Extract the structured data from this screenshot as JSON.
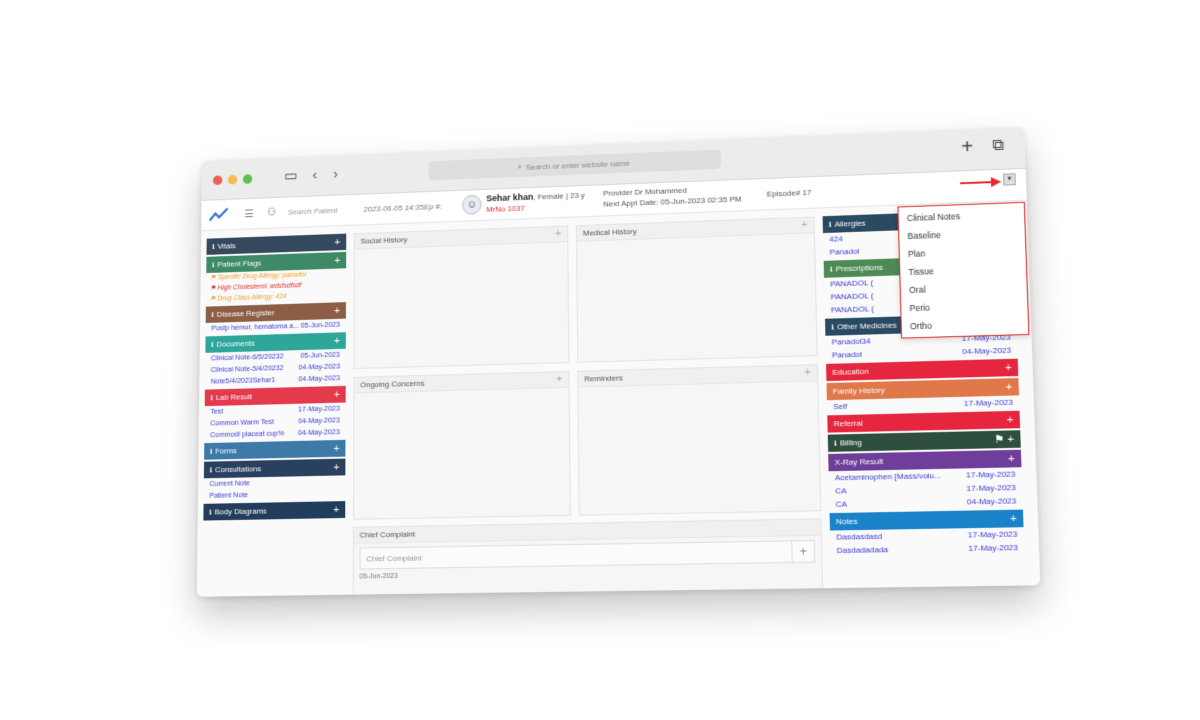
{
  "browser": {
    "address_placeholder": "Search or enter website name"
  },
  "header": {
    "search_placeholder": "Search Patient",
    "datetime": "2023-06-05 14:35Ep #:",
    "patient_name": "Sehar khan",
    "patient_info": ", Female | 23 y",
    "mrno": "MrNo 1037",
    "provider": "Provider   Dr Mohammed",
    "next_appt": "Next Appt Date: 05-Jun-2023 02:35 PM",
    "episode": "Episode# 17"
  },
  "left": {
    "vitals": "Vitals",
    "patient_flags": "Patient Flags",
    "flags": [
      "Specific Drug Allergy: panadol",
      "High Cholesterol: wdsfsdfsdf",
      "Drug Class Allergy: 424"
    ],
    "disease_register": "Disease Register",
    "disease_row": {
      "name": "Postp hemor, hematoma a...",
      "date": "05-Jun-2023"
    },
    "documents": "Documents",
    "documents_rows": [
      {
        "name": "Clinical Note-6/5/20232",
        "date": "05-Jun-2023"
      },
      {
        "name": "Clinical Note-5/4/20232",
        "date": "04-May-2023"
      },
      {
        "name": "Note5/4/2023Sehar1",
        "date": "04-May-2023"
      }
    ],
    "lab_result": "Lab Result",
    "lab_rows": [
      {
        "name": "Test",
        "date": "17-May-2023"
      },
      {
        "name": "Common Warm Test",
        "date": "04-May-2023"
      },
      {
        "name": "Commodi placeat cup%",
        "date": "04-May-2023"
      }
    ],
    "forms": "Forms",
    "consultations": "Consultations",
    "consult_rows": [
      "Current Note",
      "Patient Note"
    ],
    "body_diagrams": "Body Diagrams"
  },
  "center": {
    "social_history": "Social History",
    "medical_history": "Medical History",
    "ongoing_concerns": "Ongoing Concerns",
    "reminders": "Reminders",
    "chief_complaint_title": "Chief Complaint",
    "chief_complaint_placeholder": "Chief Complaint",
    "bottom_date": "05-Jun-2023"
  },
  "right": {
    "allergies": "Allergies",
    "allergy_rows": [
      "424",
      "Panadol"
    ],
    "prescriptions": "Prescriptions",
    "prescription_rows": [
      "PANADOL (",
      "PANADOL (",
      "PANADOL ("
    ],
    "other_medicines": "Other Medicines",
    "other_rows": [
      {
        "name": "Panadol34",
        "date": "17-May-2023"
      },
      {
        "name": "Panadol",
        "date": "04-May-2023"
      }
    ],
    "education": "Education",
    "family_history": "Family History",
    "family_rows": [
      {
        "name": "Self",
        "date": "17-May-2023"
      }
    ],
    "referral": "Referral",
    "billing": "Billing",
    "xray": "X-Ray Result",
    "xray_rows": [
      {
        "name": "Acetaminophen [Mass/volu...",
        "date": "17-May-2023"
      },
      {
        "name": "CA",
        "date": "17-May-2023"
      },
      {
        "name": "CA",
        "date": "04-May-2023"
      }
    ],
    "notes": "Notes",
    "notes_rows": [
      {
        "name": "Dasdasdasd",
        "date": "17-May-2023"
      },
      {
        "name": "Dasdadadada",
        "date": "17-May-2023"
      }
    ]
  },
  "dropdown": [
    "Clinical Notes",
    "Baseline",
    "Plan",
    "Tissue",
    "Oral",
    "Perio",
    "Ortho"
  ],
  "colors": {
    "vitals": "#34495e",
    "flags": "#3e8a67",
    "disease": "#8b5e45",
    "documents": "#2ea79a",
    "lab": "#e33a4c",
    "forms": "#3d7aa8",
    "consult": "#2a405f",
    "body": "#223c5c",
    "allergies": "#2a4a62",
    "prescriptions": "#4e8a56",
    "other": "#2a4a62",
    "education": "#e5263e",
    "family": "#e0784a",
    "referral": "#e5263e",
    "billing": "#2f4f3e",
    "xray": "#6e3e9a",
    "notes": "#1a82c8"
  }
}
